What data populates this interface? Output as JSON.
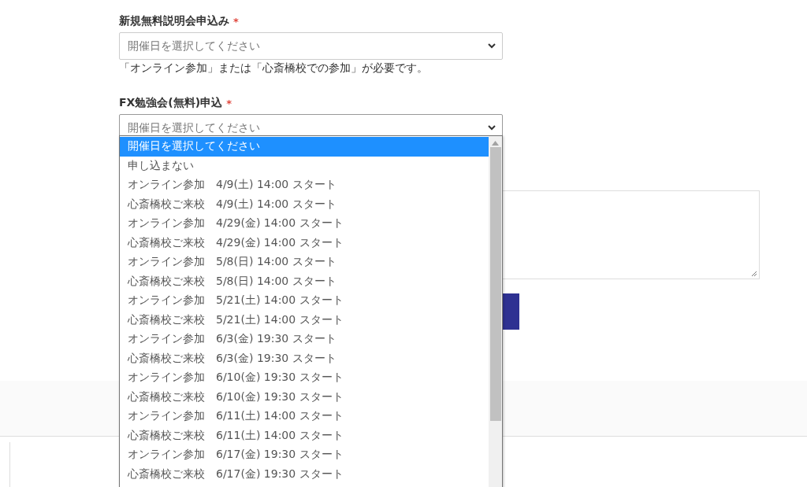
{
  "seminar": {
    "label": "新規無料説明会申込み",
    "required_mark": "*",
    "select": {
      "value": "開催日を選択してください"
    },
    "note": "「オンライン参加」または「心斎橋校での参加」が必要です。"
  },
  "study": {
    "label": "FX勉強会(無料)申込",
    "required_mark": "*",
    "select": {
      "value": "開催日を選択してください",
      "expanded": true
    },
    "options": [
      {
        "label": "開催日を選択してください",
        "selected": true
      },
      {
        "label": "申し込まない",
        "selected": false
      },
      {
        "label": "オンライン参加　4/9(土) 14:00 スタート",
        "selected": false
      },
      {
        "label": "心斎橋校ご来校　4/9(土) 14:00 スタート",
        "selected": false
      },
      {
        "label": "オンライン参加　4/29(金) 14:00 スタート",
        "selected": false
      },
      {
        "label": "心斎橋校ご来校　4/29(金) 14:00 スタート",
        "selected": false
      },
      {
        "label": "オンライン参加　5/8(日) 14:00 スタート",
        "selected": false
      },
      {
        "label": "心斎橋校ご来校　5/8(日) 14:00 スタート",
        "selected": false
      },
      {
        "label": "オンライン参加　5/21(土) 14:00 スタート",
        "selected": false
      },
      {
        "label": "心斎橋校ご来校　5/21(土) 14:00 スタート",
        "selected": false
      },
      {
        "label": "オンライン参加　6/3(金) 19:30 スタート",
        "selected": false
      },
      {
        "label": "心斎橋校ご来校　6/3(金) 19:30 スタート",
        "selected": false
      },
      {
        "label": "オンライン参加　6/10(金) 19:30 スタート",
        "selected": false
      },
      {
        "label": "心斎橋校ご来校　6/10(金) 19:30 スタート",
        "selected": false
      },
      {
        "label": "オンライン参加　6/11(土) 14:00 スタート",
        "selected": false
      },
      {
        "label": "心斎橋校ご来校　6/11(土) 14:00 スタート",
        "selected": false
      },
      {
        "label": "オンライン参加　6/17(金) 19:30 スタート",
        "selected": false
      },
      {
        "label": "心斎橋校ご来校　6/17(金) 19:30 スタート",
        "selected": false
      }
    ]
  }
}
